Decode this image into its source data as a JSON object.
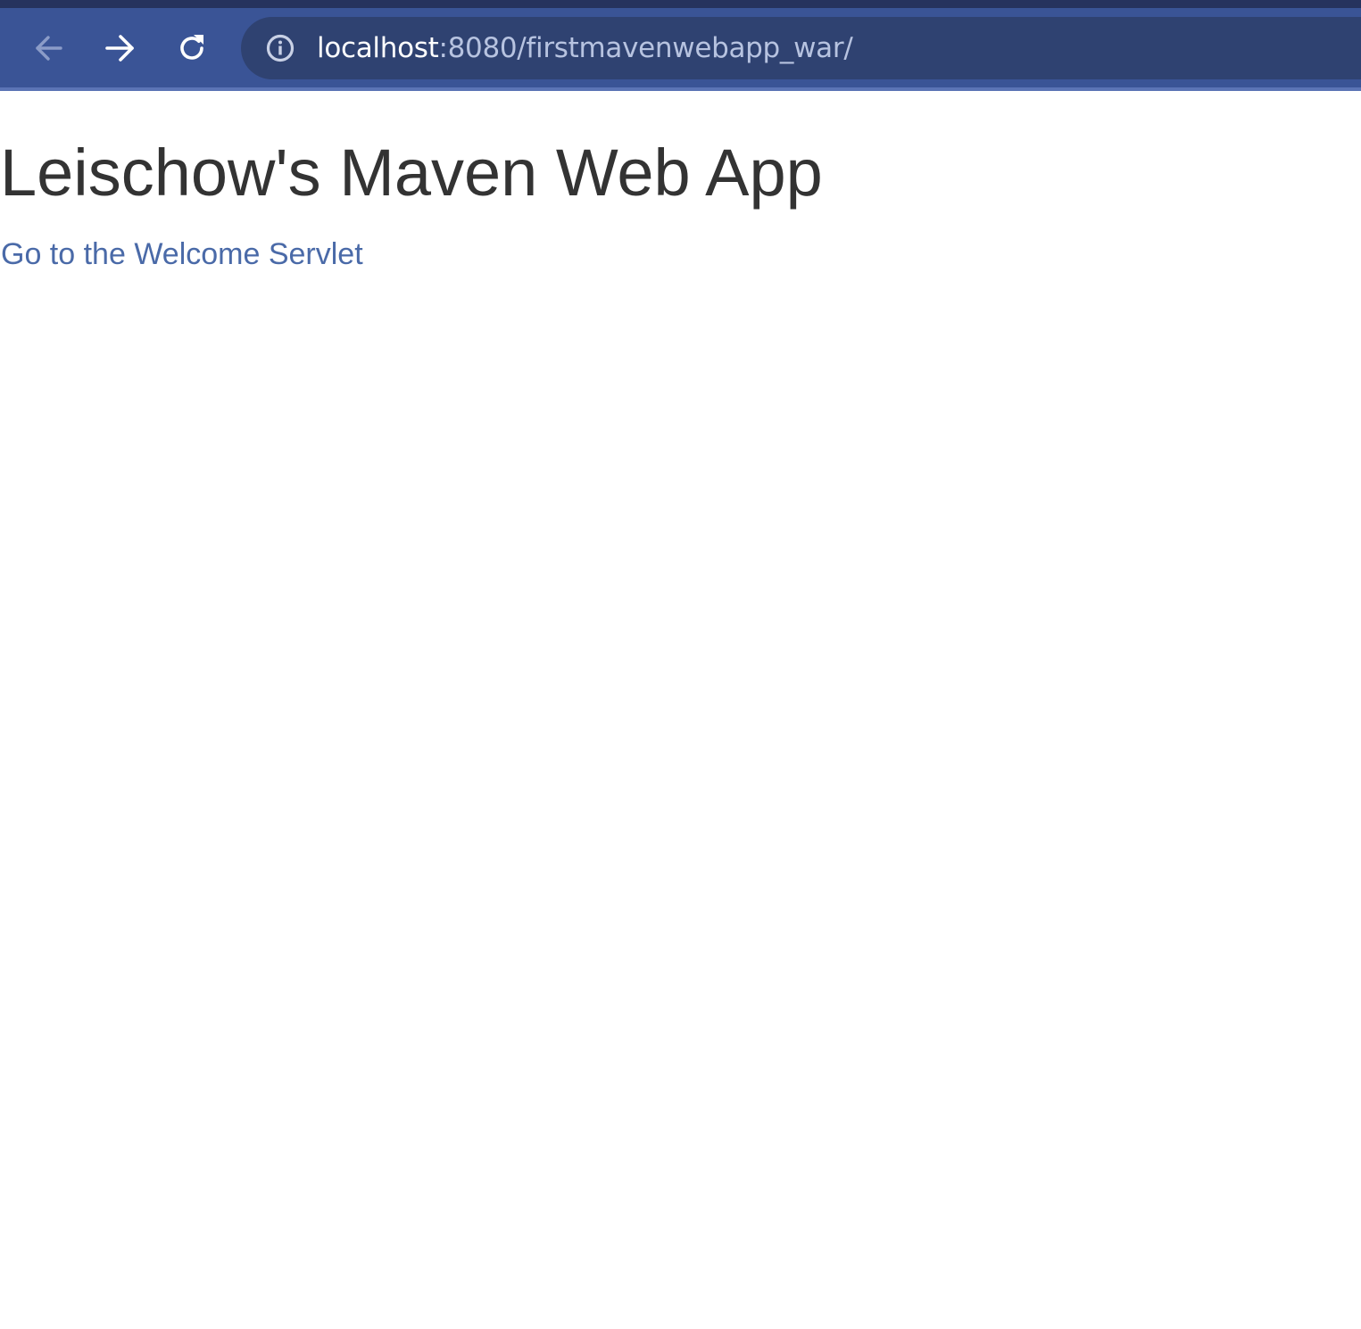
{
  "browser": {
    "address_bar": {
      "host": "localhost",
      "path": ":8080/firstmavenwebapp_war/"
    },
    "buttons": {
      "back_icon": "arrow-left-icon",
      "forward_icon": "arrow-right-icon",
      "reload_icon": "reload-icon",
      "site_info_icon": "info-icon"
    },
    "colors": {
      "toolbar": "#3a5496",
      "omnibox": "#2f4271",
      "top_strip": "#26335e"
    }
  },
  "page": {
    "title": "Leischow's Maven Web App",
    "link_text": "Go to the Welcome Servlet",
    "colors": {
      "title": "#333333",
      "link": "#4a6aa8"
    }
  }
}
